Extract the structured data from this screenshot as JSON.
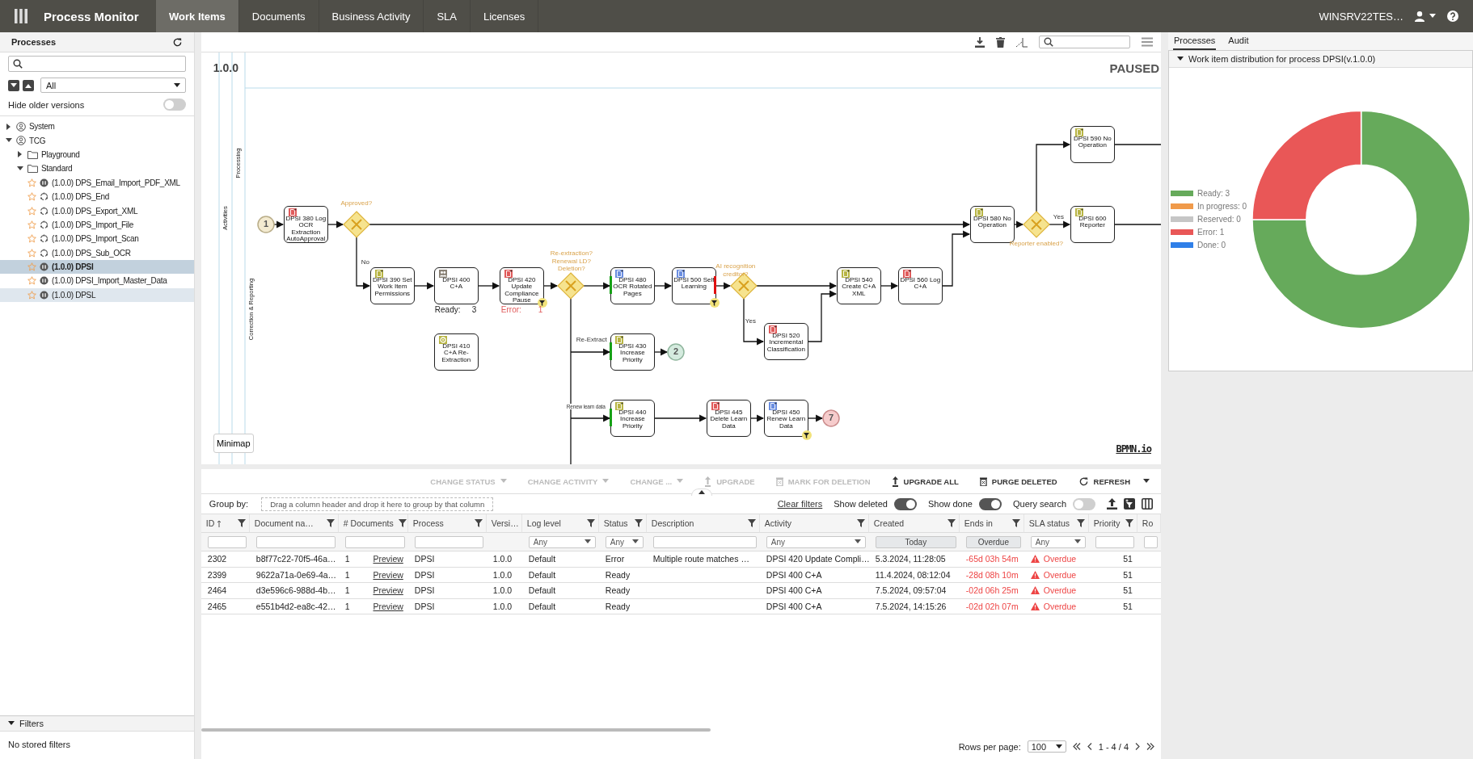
{
  "top_bar": {
    "title": "Process Monitor",
    "tabs": [
      {
        "label": "Work Items",
        "selected": true
      },
      {
        "label": "Documents",
        "selected": false
      },
      {
        "label": "Business Activity",
        "selected": false
      },
      {
        "label": "SLA",
        "selected": false
      },
      {
        "label": "Licenses",
        "selected": false
      }
    ],
    "user": "WINSRV22TES…"
  },
  "sidebar": {
    "title": "Processes",
    "filter_select": "All",
    "hide_older_versions": {
      "label": "Hide older versions",
      "on": false
    },
    "tree": [
      {
        "label": "System",
        "kind": "group",
        "expanded": false
      },
      {
        "label": "TCG",
        "kind": "group",
        "expanded": true,
        "children": [
          {
            "label": "Playground",
            "kind": "folder",
            "expanded": false
          },
          {
            "label": "Standard",
            "kind": "folder",
            "expanded": true,
            "children": [
              {
                "label": "(1.0.0) DPS_Email_Import_PDF_XML",
                "kind": "paused",
                "starred": false,
                "selected": false,
                "hovered": false
              },
              {
                "label": "(1.0.0) DPS_End",
                "kind": "idle",
                "starred": false,
                "selected": false,
                "hovered": false
              },
              {
                "label": "(1.0.0) DPS_Export_XML",
                "kind": "idle",
                "starred": false,
                "selected": false,
                "hovered": false
              },
              {
                "label": "(1.0.0) DPS_Import_File",
                "kind": "idle",
                "starred": false,
                "selected": false,
                "hovered": false
              },
              {
                "label": "(1.0.0) DPS_Import_Scan",
                "kind": "idle",
                "starred": false,
                "selected": false,
                "hovered": false
              },
              {
                "label": "(1.0.0) DPS_Sub_OCR",
                "kind": "idle",
                "starred": false,
                "selected": false,
                "hovered": false
              },
              {
                "label": "(1.0.0) DPSI",
                "kind": "paused",
                "starred": false,
                "selected": true,
                "hovered": false
              },
              {
                "label": "(1.0.0) DPSI_Import_Master_Data",
                "kind": "paused",
                "starred": false,
                "selected": false,
                "hovered": false
              },
              {
                "label": "(1.0.0) DPSL",
                "kind": "paused",
                "starred": false,
                "selected": false,
                "hovered": true
              }
            ]
          }
        ]
      }
    ],
    "filters": {
      "title": "Filters",
      "expanded": true,
      "empty_text": "No stored filters"
    }
  },
  "diagram": {
    "version": "1.0.0",
    "status_label": "PAUSED",
    "lanes": [
      "Activities",
      "Processing",
      "Correction & Reporting"
    ],
    "events": [
      {
        "label": "1",
        "kind": "start"
      },
      {
        "label": "2",
        "kind": "end"
      },
      {
        "label": "7",
        "kind": "error"
      }
    ],
    "gateways": [
      {
        "label": "Approved?"
      },
      {
        "label": "Reporter enabled?"
      },
      {
        "label": "Re-extraction? Renewal LD? Deletion?"
      },
      {
        "label": "AI recognition creditor?"
      }
    ],
    "tasks": [
      {
        "label": "DPSI 590 No Operation",
        "kind": "document",
        "color": "#b8b545",
        "ok_marker": false,
        "error_marker": false,
        "filter_badge": false
      },
      {
        "label": "DPSI 380 Log OCR Extraction AutoApproval",
        "kind": "document",
        "color": "#e05b5b",
        "ok_marker": false,
        "error_marker": false,
        "filter_badge": false
      },
      {
        "label": "DPSI 580 No Operation",
        "kind": "document",
        "color": "#b8b545",
        "ok_marker": false,
        "error_marker": false,
        "filter_badge": false
      },
      {
        "label": "DPSI 600 Reporter",
        "kind": "document",
        "color": "#b8b545",
        "ok_marker": false,
        "error_marker": false,
        "filter_badge": false
      },
      {
        "label": "DPSI 390 Set Work Item Permissions",
        "kind": "document",
        "color": "#b8b545",
        "ok_marker": false,
        "error_marker": false,
        "filter_badge": false
      },
      {
        "label": "DPSI 400 C+A",
        "kind": "user",
        "color": "#8a8276",
        "ok_marker": false,
        "error_marker": false,
        "filter_badge": false
      },
      {
        "label": "DPSI 420 Update Compliance Pause",
        "kind": "document",
        "color": "#e05b5b",
        "ok_marker": false,
        "error_marker": false,
        "filter_badge": true
      },
      {
        "label": "DPSI 480 OCR Rotated Pages",
        "kind": "document",
        "color": "#6b8ee0",
        "ok_marker": true,
        "error_marker": false,
        "filter_badge": false
      },
      {
        "label": "DPSI 500 Self Learning",
        "kind": "document",
        "color": "#6b8ee0",
        "ok_marker": false,
        "error_marker": true,
        "filter_badge": true
      },
      {
        "label": "DPSI 540 Create C+A XML",
        "kind": "document",
        "color": "#b8b545",
        "ok_marker": false,
        "error_marker": false,
        "filter_badge": false
      },
      {
        "label": "DPSI 560 Log C+A",
        "kind": "document",
        "color": "#e05b5b",
        "ok_marker": false,
        "error_marker": false,
        "filter_badge": false
      },
      {
        "label": "DPSI 520 Incremental Classification",
        "kind": "document",
        "color": "#e05b5b",
        "ok_marker": false,
        "error_marker": false,
        "filter_badge": false
      },
      {
        "label": "DPSI 410 C+A Re-Extraction",
        "kind": "service",
        "color": "#b8b545",
        "ok_marker": false,
        "error_marker": false,
        "filter_badge": false
      },
      {
        "label": "DPSI 430 Increase Priority",
        "kind": "document",
        "color": "#b8b545",
        "ok_marker": true,
        "error_marker": false,
        "filter_badge": false
      },
      {
        "label": "DPSI 440 Increase Priority",
        "kind": "document",
        "color": "#b8b545",
        "ok_marker": true,
        "error_marker": false,
        "filter_badge": false
      },
      {
        "label": "DPSI 445 Delete Learn Data",
        "kind": "document",
        "color": "#e05b5b",
        "ok_marker": false,
        "error_marker": false,
        "filter_badge": false
      },
      {
        "label": "DPSI 450 Renew Learn Data",
        "kind": "document",
        "color": "#6b8ee0",
        "ok_marker": false,
        "error_marker": false,
        "filter_badge": true
      }
    ],
    "flow_labels": [
      "Yes",
      "No",
      "Yes",
      "Re-Extract",
      "Renew learn data"
    ],
    "counters": [
      {
        "label": "Ready:",
        "count": "3",
        "kind": "ready"
      },
      {
        "label": "Error:",
        "count": "1",
        "kind": "error"
      }
    ],
    "minimap": "Minimap",
    "logo": "BPMN.io"
  },
  "table": {
    "actions": [
      {
        "label": "CHANGE STATUS",
        "kind": "menu",
        "disabled": true
      },
      {
        "label": "CHANGE ACTIVITY",
        "kind": "menu",
        "disabled": true
      },
      {
        "label": "CHANGE ...",
        "kind": "menu",
        "disabled": true
      },
      {
        "label": "UPGRADE",
        "kind": "upgrade",
        "disabled": true
      },
      {
        "label": "MARK FOR DELETION",
        "kind": "delete",
        "disabled": true
      },
      {
        "label": "UPGRADE ALL",
        "kind": "upgrade",
        "disabled": false
      },
      {
        "label": "PURGE DELETED",
        "kind": "delete",
        "disabled": false
      },
      {
        "label": "REFRESH",
        "kind": "refresh",
        "disabled": false
      }
    ],
    "group_by": {
      "label": "Group by:",
      "placeholder": "Drag a column header and drop it here to group by that column"
    },
    "clear_filters": "Clear filters",
    "toggles": [
      {
        "label": "Show deleted",
        "on": true
      },
      {
        "label": "Show done",
        "on": true
      },
      {
        "label": "Query search",
        "on": false
      }
    ],
    "columns": [
      {
        "label": "ID",
        "sorted": true,
        "kind": "text"
      },
      {
        "label": "Document na…",
        "sorted": false,
        "kind": "text"
      },
      {
        "label": "# Documents",
        "sorted": false,
        "kind": "text"
      },
      {
        "label": "Process",
        "sorted": false,
        "kind": "text"
      },
      {
        "label": "Versi…",
        "sorted": false,
        "kind": "plain"
      },
      {
        "label": "Log level",
        "sorted": false,
        "kind": "select",
        "value": "Any"
      },
      {
        "label": "Status",
        "sorted": false,
        "kind": "select",
        "value": "Any"
      },
      {
        "label": "Description",
        "sorted": false,
        "kind": "text"
      },
      {
        "label": "Activity",
        "sorted": false,
        "kind": "select",
        "value": "Any"
      },
      {
        "label": "Created",
        "sorted": false,
        "kind": "button",
        "value": "Today"
      },
      {
        "label": "Ends in",
        "sorted": false,
        "kind": "button",
        "value": "Overdue"
      },
      {
        "label": "SLA status",
        "sorted": false,
        "kind": "select",
        "value": "Any"
      },
      {
        "label": "Priority",
        "sorted": false,
        "kind": "text"
      },
      {
        "label": "Ro",
        "sorted": false,
        "kind": "text"
      }
    ],
    "rows": [
      {
        "id": "2302",
        "document": "b8f77c22-70f5-46a…",
        "documents": "1",
        "preview": "Preview",
        "process": "DPSI",
        "version": "1.0.0",
        "log_level": "Default",
        "status": "Error",
        "description": "Multiple route matches …",
        "activity": "DPSI 420 Update Compli…",
        "created": "5.3.2024, 11:28:05",
        "ends_in": "-65d 03h 54m",
        "sla_status": "Overdue",
        "priority": "51",
        "overdue": true
      },
      {
        "id": "2399",
        "document": "9622a71a-0e69-4a…",
        "documents": "1",
        "preview": "Preview",
        "process": "DPSI",
        "version": "1.0.0",
        "log_level": "Default",
        "status": "Ready",
        "activity": "DPSI 400 C+A",
        "created": "11.4.2024, 08:12:04",
        "ends_in": "-28d 08h 10m",
        "sla_status": "Overdue",
        "priority": "51",
        "overdue": true
      },
      {
        "id": "2464",
        "document": "d3e596c6-988d-4b…",
        "documents": "1",
        "preview": "Preview",
        "process": "DPSI",
        "version": "1.0.0",
        "log_level": "Default",
        "status": "Ready",
        "activity": "DPSI 400 C+A",
        "created": "7.5.2024, 09:57:04",
        "ends_in": "-02d 06h 25m",
        "sla_status": "Overdue",
        "priority": "51",
        "overdue": true
      },
      {
        "id": "2465",
        "document": "e551b4d2-ea8c-42…",
        "documents": "1",
        "preview": "Preview",
        "process": "DPSI",
        "version": "1.0.0",
        "log_level": "Default",
        "status": "Ready",
        "activity": "DPSI 400 C+A",
        "created": "7.5.2024, 14:15:26",
        "ends_in": "-02d 02h 07m",
        "sla_status": "Overdue",
        "priority": "51",
        "overdue": true
      }
    ],
    "pagination": {
      "rows_per_page_label": "Rows per page:",
      "rows_per_page": "100",
      "range": "1 - 4 / 4"
    }
  },
  "right_panel": {
    "tabs": [
      {
        "label": "Processes",
        "selected": true
      },
      {
        "label": "Audit",
        "selected": false
      }
    ],
    "card": {
      "title": "Work item distribution for process DPSI(v.1.0.0)",
      "expanded": true,
      "legend": [
        {
          "label": "Ready: 3",
          "color": "#66aa5b"
        },
        {
          "label": "In progress: 0",
          "color": "#f09a4a"
        },
        {
          "label": "Reserved: 0",
          "color": "#c6c6c6"
        },
        {
          "label": "Error: 1",
          "color": "#e95757"
        },
        {
          "label": "Done: 0",
          "color": "#2f7fe8"
        }
      ],
      "chart_data": {
        "type": "donut",
        "values": [
          75,
          0,
          0,
          25,
          0
        ]
      }
    }
  }
}
